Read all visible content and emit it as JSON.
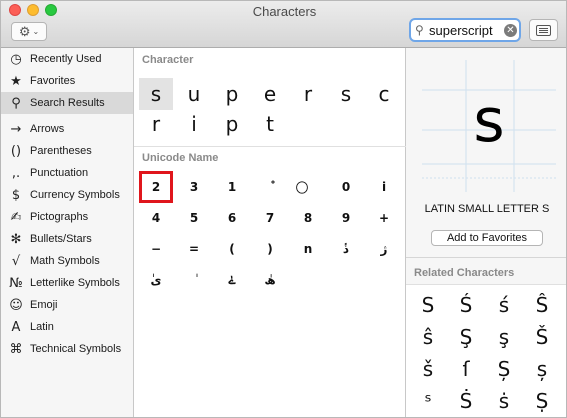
{
  "window": {
    "title": "Characters"
  },
  "toolbar": {
    "search_value": "superscript",
    "clear_glyph": "✕",
    "gear_glyph": "⚙",
    "chevron_glyph": "⌄",
    "search_glyph": "⚲"
  },
  "sidebar": {
    "items": [
      {
        "icon": "◷",
        "icon_name": "clock-icon",
        "label": "Recently Used"
      },
      {
        "icon": "★",
        "icon_name": "star-icon",
        "label": "Favorites"
      },
      {
        "icon": "⚲",
        "icon_name": "search-icon",
        "label": "Search Results",
        "selected": true
      },
      {
        "icon": "→",
        "icon_name": "arrow-icon",
        "label": "Arrows"
      },
      {
        "icon": "()",
        "icon_name": "parentheses-icon",
        "label": "Parentheses"
      },
      {
        "icon": ",.",
        "icon_name": "punctuation-icon",
        "label": "Punctuation"
      },
      {
        "icon": "$",
        "icon_name": "dollar-icon",
        "label": "Currency Symbols"
      },
      {
        "icon": "✍",
        "icon_name": "pictograph-icon",
        "label": "Pictographs"
      },
      {
        "icon": "✻",
        "icon_name": "bullet-star-icon",
        "label": "Bullets/Stars"
      },
      {
        "icon": "√",
        "icon_name": "square-root-icon",
        "label": "Math Symbols"
      },
      {
        "icon": "№",
        "icon_name": "numero-icon",
        "label": "Letterlike Symbols"
      },
      {
        "icon": "☺",
        "icon_name": "smiley-icon",
        "label": "Emoji"
      },
      {
        "icon": "A",
        "icon_name": "latin-a-icon",
        "label": "Latin"
      },
      {
        "icon": "⌘",
        "icon_name": "command-icon",
        "label": "Technical Symbols"
      }
    ]
  },
  "main": {
    "character_header": "Character",
    "unicode_header": "Unicode Name",
    "characters": [
      "s",
      "u",
      "p",
      "e",
      "r",
      "s",
      "c",
      "r",
      "i",
      "p",
      "t"
    ],
    "unicode_chars": [
      "2",
      "3",
      "1",
      "ْ",
      "⃝",
      "0",
      "i",
      "4",
      "5",
      "6",
      "7",
      "8",
      "9",
      "+",
      "−",
      "=",
      "(",
      ")",
      "n",
      "ٔذ",
      "ژ",
      "ٰی",
      "ٰ",
      "ےٰ",
      "ھٰ"
    ]
  },
  "detail": {
    "glyph": "s",
    "name": "LATIN SMALL LETTER S",
    "add_favorites": "Add to Favorites",
    "related_header": "Related Characters",
    "related": [
      "S",
      "Ś",
      "ś",
      "Ŝ",
      "ŝ",
      "Ş",
      "ş",
      "Š",
      "š",
      "ſ",
      "Ș",
      "ș",
      "ˢ",
      "Ṡ",
      "ṡ",
      "Ṣ"
    ]
  }
}
